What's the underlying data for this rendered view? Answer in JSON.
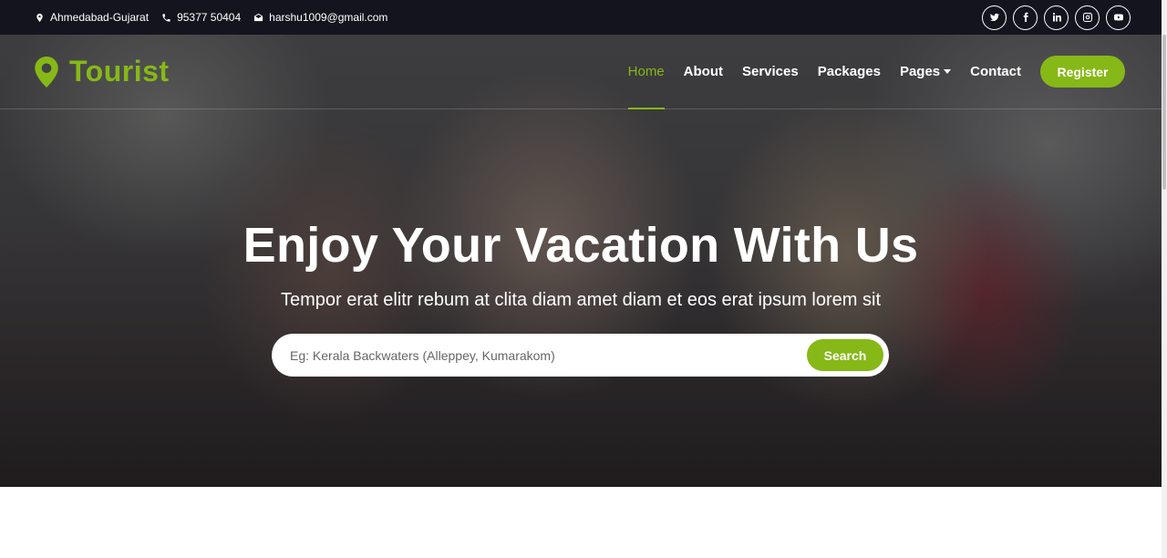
{
  "topbar": {
    "location": "Ahmedabad-Gujarat",
    "phone": "95377 50404",
    "email": "harshu1009@gmail.com",
    "socials": [
      "twitter-icon",
      "facebook-icon",
      "linkedin-icon",
      "instagram-icon",
      "youtube-icon"
    ]
  },
  "brand": {
    "name": "Tourist",
    "icon": "map-marker-icon"
  },
  "nav": {
    "items": [
      "Home",
      "About",
      "Services",
      "Packages",
      "Pages",
      "Contact"
    ],
    "active": "Home",
    "register_label": "Register"
  },
  "hero": {
    "title": "Enjoy Your Vacation With Us",
    "subtitle": "Tempor erat elitr rebum at clita diam amet diam et eos erat ipsum lorem sit",
    "search": {
      "placeholder": "Eg: Kerala Backwaters (Alleppey, Kumarakom)",
      "button_label": "Search"
    }
  },
  "colors": {
    "accent": "#86b817",
    "topbar": "#14141f"
  }
}
